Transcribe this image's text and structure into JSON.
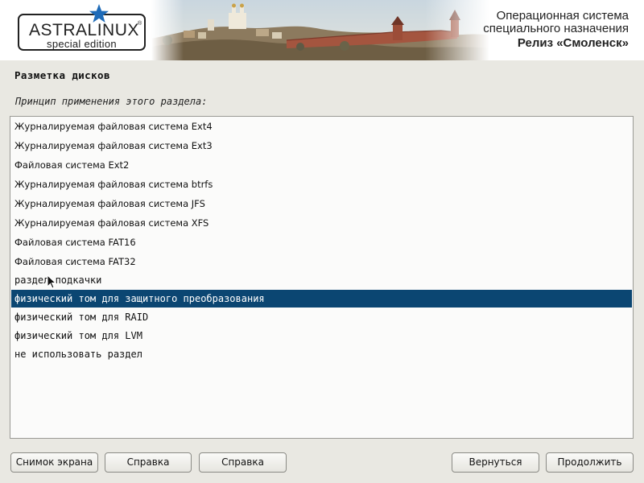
{
  "branding": {
    "logo_text": "ASTRALINUX",
    "logo_registered": "®",
    "logo_subtitle": "special edition",
    "os_title_line1": "Операционная система",
    "os_title_line2": "специального назначения",
    "release": "Релиз «Смоленск»"
  },
  "page": {
    "title": "Разметка дисков",
    "prompt": "Принцип применения этого раздела:"
  },
  "list": {
    "items": [
      "Журналируемая файловая система Ext4",
      "Журналируемая файловая система Ext3",
      "Файловая система Ext2",
      "Журналируемая файловая система btrfs",
      "Журналируемая файловая система JFS",
      "Журналируемая файловая система XFS",
      "Файловая система FAT16",
      "Файловая система FAT32",
      "раздел подкачки",
      "физический том для защитного преобразования",
      "физический том для RAID",
      "физический том для LVM",
      "не использовать раздел"
    ],
    "selected_index": 9
  },
  "buttons": {
    "screenshot": "Снимок экрана",
    "help1": "Справка",
    "help2": "Справка",
    "back": "Вернуться",
    "continue": "Продолжить"
  },
  "colors": {
    "selection_bg": "#0b4672",
    "selection_fg": "#ffffff",
    "window_bg": "#e9e8e2",
    "logo_star": "#1e6bb8"
  },
  "icons": {
    "logo_star": "star-icon",
    "pointer": "mouse-pointer-icon"
  }
}
